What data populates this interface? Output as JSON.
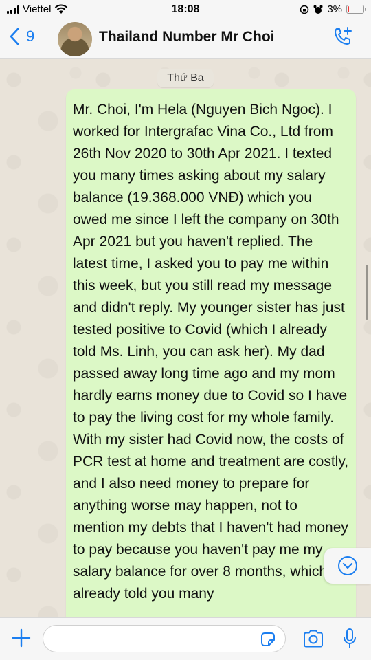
{
  "status_bar": {
    "carrier": "Viettel",
    "time": "18:08",
    "battery": "3%",
    "battery_level": 0.03,
    "icons": [
      "signal-icon",
      "wifi-icon",
      "orientation-lock-icon",
      "alarm-icon",
      "battery-icon"
    ]
  },
  "header": {
    "back_count": "9",
    "contact_name": "Thailand Number Mr Choi",
    "icons": [
      "back-chevron-icon",
      "avatar",
      "add-call-icon"
    ]
  },
  "chat": {
    "day_label": "Thứ Ba",
    "message_text": "Mr. Choi, I'm Hela (Nguyen Bich Ngoc). I worked for Intergrafac Vina Co., Ltd from 26th Nov 2020 to 30th Apr 2021. I texted you many times asking about my salary balance (19.368.000 VNĐ) which you owed me since I left the company on 30th Apr 2021 but you haven't replied. The latest time, I asked you to pay me within this week, but you still read my message and didn't reply. My younger sister has just tested positive to Covid (which I already told Ms. Linh, you can ask her). My dad passed away long time ago and my mom hardly earns money due to Covid so I have to pay the living cost for my whole family. With my sister had Covid now, the costs of PCR test at home and treatment are costly, and I also need money to prepare for anything worse may happen, not to mention my debts that I haven't had money to pay because you haven't pay me my salary balance for over 8 months, which I already told you many"
  },
  "input_bar": {
    "placeholder": "",
    "icons": [
      "plus-icon",
      "sticker-icon",
      "camera-icon",
      "microphone-icon"
    ]
  },
  "colors": {
    "accent": "#1b7ef0",
    "bubble_outgoing": "#dcf8c6",
    "bar_background": "#f6f6f6"
  }
}
